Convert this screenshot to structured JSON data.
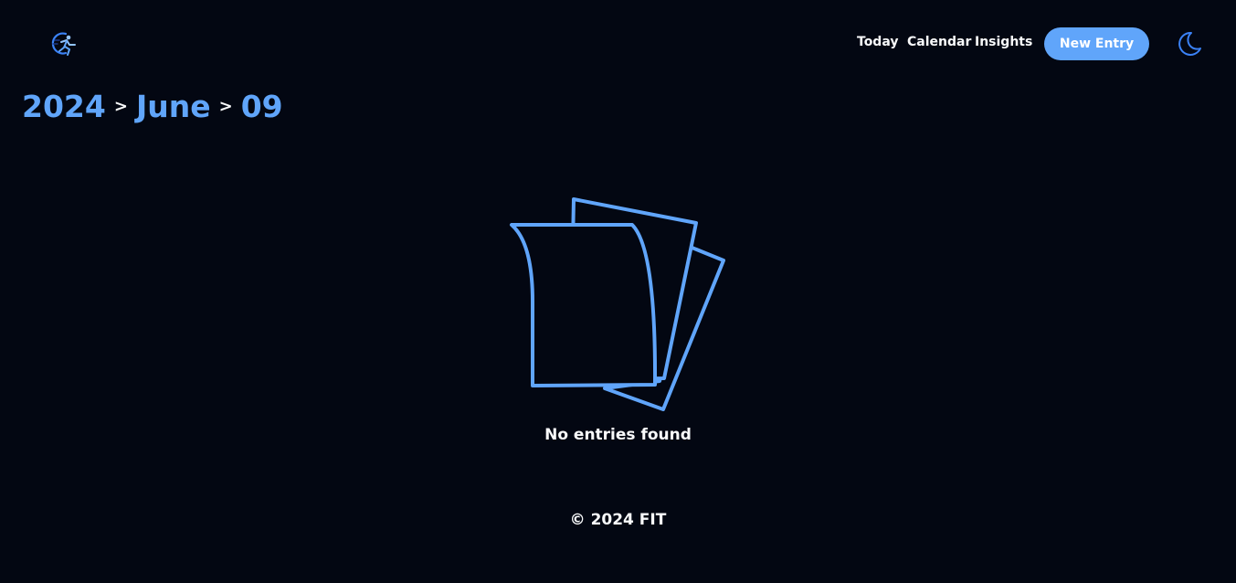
{
  "header": {
    "logo_icon": "runner-logo-icon",
    "nav": {
      "today_label": "Today",
      "calendar_label": "Calendar",
      "insights_label": "Insights"
    },
    "new_entry_label": "New Entry",
    "theme_toggle_icon": "moon-icon"
  },
  "breadcrumb": {
    "year": "2024",
    "month": "June",
    "day": "09",
    "separator": ">"
  },
  "empty_state": {
    "icon": "documents-icon",
    "message": "No entries found"
  },
  "footer": {
    "copyright": "© 2024 FIT"
  },
  "colors": {
    "background": "#030712",
    "accent": "#60a5fa",
    "text": "#f9fafb"
  }
}
